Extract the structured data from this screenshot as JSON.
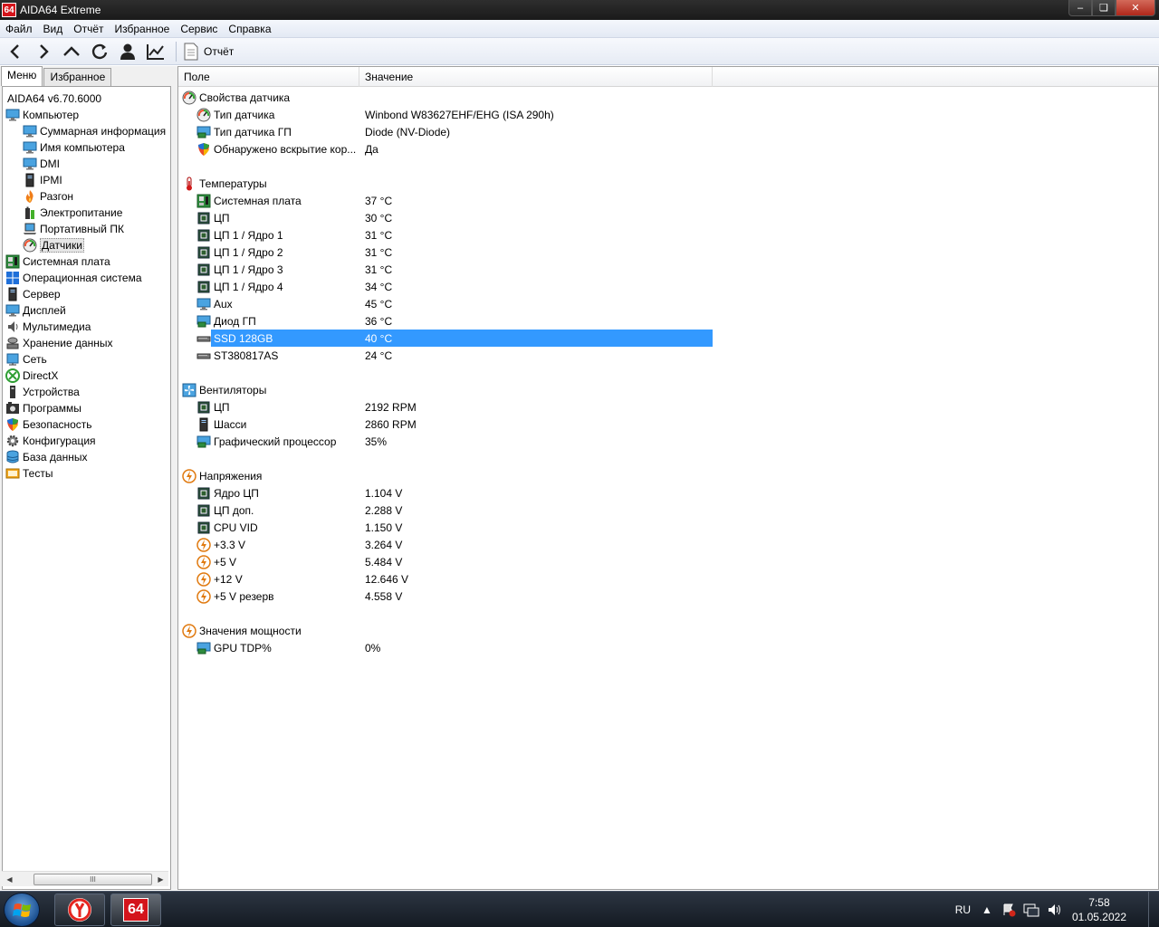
{
  "window": {
    "icon_text": "64",
    "title": "AIDA64 Extreme",
    "controls": [
      "minimize",
      "maximize",
      "close"
    ]
  },
  "menubar": {
    "items": [
      "Файл",
      "Вид",
      "Отчёт",
      "Избранное",
      "Сервис",
      "Справка"
    ]
  },
  "toolbar": {
    "buttons": [
      "back-icon",
      "forward-icon",
      "up-icon",
      "refresh-icon",
      "user-icon",
      "graph-icon"
    ],
    "report_label": "Отчёт"
  },
  "left": {
    "tabs": [
      "Меню",
      "Избранное"
    ],
    "tree": [
      {
        "label": "AIDA64 v6.70.6000",
        "level": 0,
        "icon": "none"
      },
      {
        "label": "Компьютер",
        "level": 0,
        "icon": "monitor-icon"
      },
      {
        "label": "Суммарная информация",
        "level": 1,
        "icon": "monitor-icon"
      },
      {
        "label": "Имя компьютера",
        "level": 1,
        "icon": "monitor-icon"
      },
      {
        "label": "DMI",
        "level": 1,
        "icon": "monitor-icon"
      },
      {
        "label": "IPMI",
        "level": 1,
        "icon": "server-icon"
      },
      {
        "label": "Разгон",
        "level": 1,
        "icon": "flame-icon"
      },
      {
        "label": "Электропитание",
        "level": 1,
        "icon": "battery-icon"
      },
      {
        "label": "Портативный ПК",
        "level": 1,
        "icon": "laptop-icon"
      },
      {
        "label": "Датчики",
        "level": 1,
        "icon": "gauge-icon",
        "selected": true
      },
      {
        "label": "Системная плата",
        "level": 0,
        "icon": "motherboard-icon"
      },
      {
        "label": "Операционная система",
        "level": 0,
        "icon": "windows-icon"
      },
      {
        "label": "Сервер",
        "level": 0,
        "icon": "server-icon"
      },
      {
        "label": "Дисплей",
        "level": 0,
        "icon": "monitor-icon"
      },
      {
        "label": "Мультимедиа",
        "level": 0,
        "icon": "speaker-icon"
      },
      {
        "label": "Хранение данных",
        "level": 0,
        "icon": "storage-icon"
      },
      {
        "label": "Сеть",
        "level": 0,
        "icon": "network-icon"
      },
      {
        "label": "DirectX",
        "level": 0,
        "icon": "xbox-icon"
      },
      {
        "label": "Устройства",
        "level": 0,
        "icon": "device-icon"
      },
      {
        "label": "Программы",
        "level": 0,
        "icon": "programs-icon"
      },
      {
        "label": "Безопасность",
        "level": 0,
        "icon": "shield-icon"
      },
      {
        "label": "Конфигурация",
        "level": 0,
        "icon": "config-icon"
      },
      {
        "label": "База данных",
        "level": 0,
        "icon": "database-icon"
      },
      {
        "label": "Тесты",
        "level": 0,
        "icon": "tests-icon"
      }
    ],
    "scroll_thumb_glyph": "III"
  },
  "table": {
    "columns": [
      "Поле",
      "Значение"
    ],
    "rows": [
      {
        "kind": "section",
        "field": "Свойства датчика",
        "value": "",
        "icon": "gauge-icon"
      },
      {
        "kind": "item",
        "field": "Тип датчика",
        "value": "Winbond W83627EHF/EHG  (ISA 290h)",
        "icon": "gauge-icon"
      },
      {
        "kind": "item",
        "field": "Тип датчика ГП",
        "value": "Diode  (NV-Diode)",
        "icon": "gpu-icon"
      },
      {
        "kind": "item",
        "field": "Обнаружено вскрытие кор...",
        "value": "Да",
        "icon": "shield-icon"
      },
      {
        "kind": "spacer"
      },
      {
        "kind": "section",
        "field": "Температуры",
        "value": "",
        "icon": "thermometer-icon"
      },
      {
        "kind": "item",
        "field": "Системная плата",
        "value": "37 °C",
        "icon": "motherboard-icon"
      },
      {
        "kind": "item",
        "field": "ЦП",
        "value": "30 °C",
        "icon": "chip-icon"
      },
      {
        "kind": "item",
        "field": "ЦП 1 / Ядро 1",
        "value": "31 °C",
        "icon": "chip-icon"
      },
      {
        "kind": "item",
        "field": "ЦП 1 / Ядро 2",
        "value": "31 °C",
        "icon": "chip-icon"
      },
      {
        "kind": "item",
        "field": "ЦП 1 / Ядро 3",
        "value": "31 °C",
        "icon": "chip-icon"
      },
      {
        "kind": "item",
        "field": "ЦП 1 / Ядро 4",
        "value": "34 °C",
        "icon": "chip-icon"
      },
      {
        "kind": "item",
        "field": "Aux",
        "value": "45 °C",
        "icon": "monitor-icon"
      },
      {
        "kind": "item",
        "field": "Диод ГП",
        "value": "36 °C",
        "icon": "gpu-icon"
      },
      {
        "kind": "item",
        "field": "SSD 128GB",
        "value": "40 °C",
        "icon": "disk-icon",
        "selected": true
      },
      {
        "kind": "item",
        "field": "ST380817AS",
        "value": "24 °C",
        "icon": "disk-icon"
      },
      {
        "kind": "spacer"
      },
      {
        "kind": "section",
        "field": "Вентиляторы",
        "value": "",
        "icon": "fan-icon"
      },
      {
        "kind": "item",
        "field": "ЦП",
        "value": "2192 RPM",
        "icon": "chip-icon"
      },
      {
        "kind": "item",
        "field": "Шасси",
        "value": "2860 RPM",
        "icon": "server-icon"
      },
      {
        "kind": "item",
        "field": "Графический процессор",
        "value": "35%",
        "icon": "gpu-icon"
      },
      {
        "kind": "spacer"
      },
      {
        "kind": "section",
        "field": "Напряжения",
        "value": "",
        "icon": "voltage-icon"
      },
      {
        "kind": "item",
        "field": "Ядро ЦП",
        "value": "1.104 V",
        "icon": "chip-icon"
      },
      {
        "kind": "item",
        "field": "ЦП доп.",
        "value": "2.288 V",
        "icon": "chip-icon"
      },
      {
        "kind": "item",
        "field": "CPU VID",
        "value": "1.150 V",
        "icon": "chip-icon"
      },
      {
        "kind": "item",
        "field": "+3.3 V",
        "value": "3.264 V",
        "icon": "voltage-icon"
      },
      {
        "kind": "item",
        "field": "+5 V",
        "value": "5.484 V",
        "icon": "voltage-icon"
      },
      {
        "kind": "item",
        "field": "+12 V",
        "value": "12.646 V",
        "icon": "voltage-icon"
      },
      {
        "kind": "item",
        "field": "+5 V резерв",
        "value": "4.558 V",
        "icon": "voltage-icon"
      },
      {
        "kind": "spacer"
      },
      {
        "kind": "section",
        "field": "Значения мощности",
        "value": "",
        "icon": "voltage-icon"
      },
      {
        "kind": "item",
        "field": "GPU TDP%",
        "value": "0%",
        "icon": "gpu-icon"
      }
    ]
  },
  "taskbar": {
    "apps": [
      "yandex-browser-icon",
      "aida64-icon"
    ],
    "aida_icon_text": "64",
    "lang": "RU",
    "time": "7:58",
    "date": "01.05.2022"
  },
  "colors": {
    "selection": "#3399ff",
    "aida_red": "#d4141b"
  }
}
